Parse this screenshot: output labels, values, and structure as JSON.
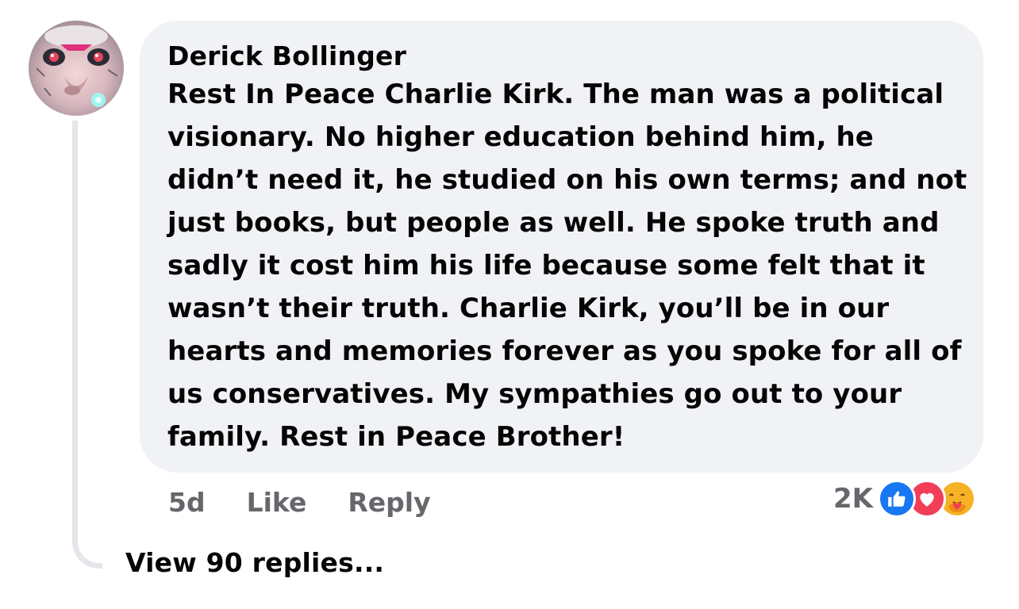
{
  "comment": {
    "author": "Derick Bollinger",
    "text": "Rest In Peace Charlie Kirk. The man was a political visionary. No higher education behind him, he didn’t need it, he studied on his own terms; and not just books, but people as well. He spoke truth and sadly it cost him his life because some felt that it wasn’t their truth. Charlie Kirk, you’ll be in our hearts and memories forever as you spoke for all of us conservatives. My sympathies go out to your family. Rest in Peace Brother!",
    "timestamp": "5d",
    "like_label": "Like",
    "reply_label": "Reply",
    "reaction_count": "2K",
    "reactions": [
      "like-icon",
      "love-icon",
      "care-icon"
    ]
  },
  "replies": {
    "view_label": "View 90 replies..."
  },
  "colors": {
    "bubble_bg": "#f0f2f5",
    "meta_text": "#65676b",
    "like_blue": "#1877f2",
    "love_red": "#f33e58",
    "care_yellow": "#f7b125"
  }
}
